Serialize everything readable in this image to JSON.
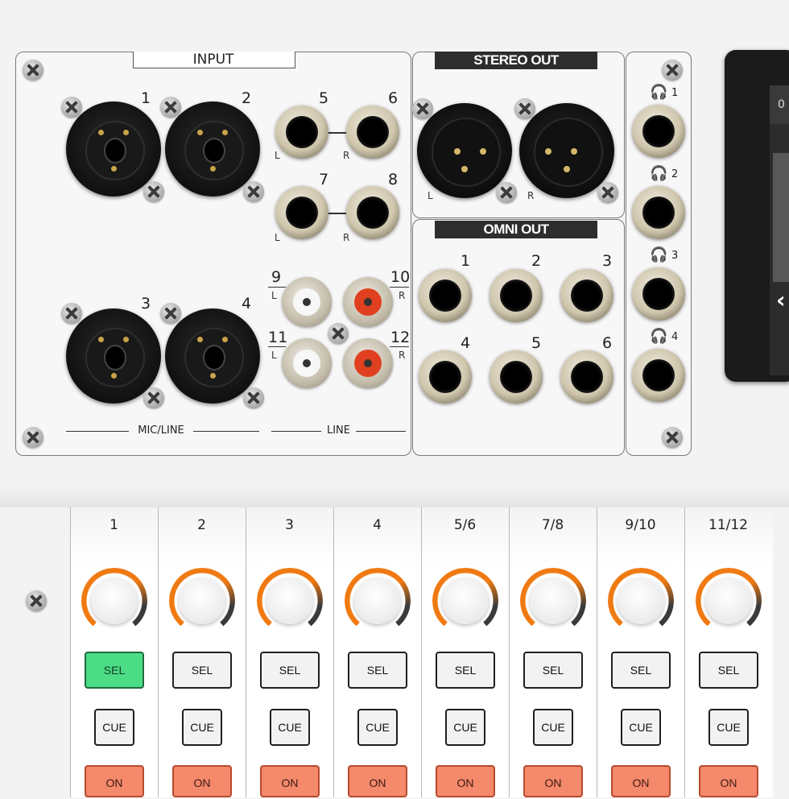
{
  "input_panel": {
    "title": "INPUT",
    "combo_numbers": [
      "1",
      "2",
      "3",
      "4"
    ],
    "jack_numbers": [
      "5",
      "6",
      "7",
      "8"
    ],
    "rca_numbers": [
      "9",
      "10",
      "11",
      "12"
    ],
    "left_label": "L",
    "right_label": "R",
    "mic_line_label": "MIC/LINE",
    "line_label": "LINE"
  },
  "stereo_out": {
    "title": "STEREO OUT",
    "left_label": "L",
    "right_label": "R"
  },
  "omni_out": {
    "title": "OMNI OUT",
    "numbers": [
      "1",
      "2",
      "3",
      "4",
      "5",
      "6"
    ]
  },
  "phones": {
    "numbers": [
      "1",
      "2",
      "3",
      "4"
    ],
    "icon": "headphones-icon"
  },
  "display": {
    "partial_text": "0"
  },
  "channels": [
    {
      "name": "1",
      "sel": "SEL",
      "cue": "CUE",
      "on": "ON",
      "selected": true
    },
    {
      "name": "2",
      "sel": "SEL",
      "cue": "CUE",
      "on": "ON",
      "selected": false
    },
    {
      "name": "3",
      "sel": "SEL",
      "cue": "CUE",
      "on": "ON",
      "selected": false
    },
    {
      "name": "4",
      "sel": "SEL",
      "cue": "CUE",
      "on": "ON",
      "selected": false
    },
    {
      "name": "5/6",
      "sel": "SEL",
      "cue": "CUE",
      "on": "ON",
      "selected": false
    },
    {
      "name": "7/8",
      "sel": "SEL",
      "cue": "CUE",
      "on": "ON",
      "selected": false
    },
    {
      "name": "9/10",
      "sel": "SEL",
      "cue": "CUE",
      "on": "ON",
      "selected": false
    },
    {
      "name": "11/12",
      "sel": "SEL",
      "cue": "CUE",
      "on": "ON",
      "selected": false
    }
  ],
  "colors": {
    "knob_ring": "#f07a12",
    "sel_active": "#4ddc86",
    "on_button": "#f4896b",
    "panel_title_bg": "#2d2d2d"
  }
}
